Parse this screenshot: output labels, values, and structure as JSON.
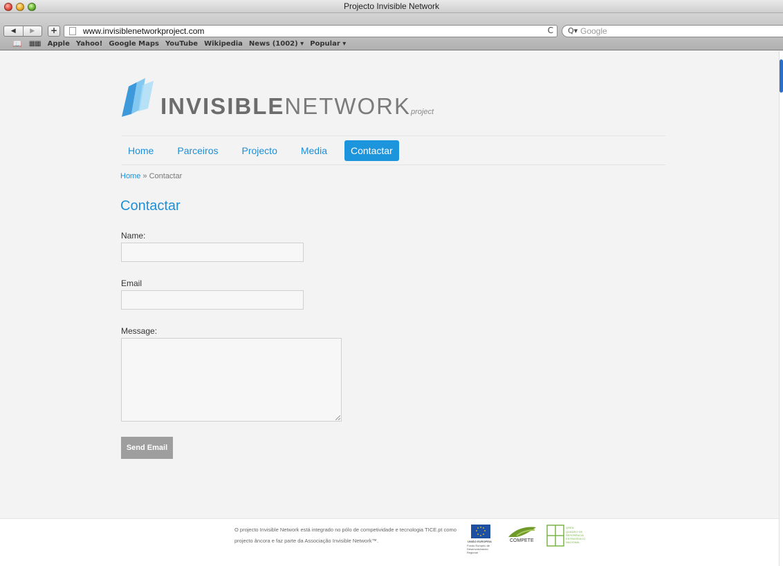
{
  "window": {
    "title": "Projecto Invisible Network"
  },
  "toolbar": {
    "back": "◀",
    "forward": "▶",
    "add": "+",
    "url": "www.invisiblenetworkproject.com",
    "reload": "C",
    "search_placeholder": "Google"
  },
  "bookmarks": [
    "Apple",
    "Yahoo!",
    "Google Maps",
    "YouTube",
    "Wikipedia",
    "News (1002) ▾",
    "Popular ▾"
  ],
  "logo": {
    "bold": "INVISIBLE",
    "light": "NETWORK",
    "sub": "project"
  },
  "nav": {
    "home": "Home",
    "parceiros": "Parceiros",
    "projecto": "Projecto",
    "media": "Media",
    "contactar": "Contactar"
  },
  "breadcrumb": {
    "home": "Home",
    "sep": " » ",
    "current": "Contactar"
  },
  "page_title": "Contactar",
  "form": {
    "name_label": "Name:",
    "email_label": "Email",
    "message_label": "Message:",
    "submit": "Send Email"
  },
  "footer": {
    "text": "O projecto Invisible Network está integrado no pólo de competividade e tecnologia TICE.pt como projecto âncora e faz parte da Associação Invisible Network™.",
    "eu_label": "UNIÃO EUROPEIA",
    "eu_sub": "Fundo Europeu de Desenvolvimento Regional",
    "compete_label": "COMPETE",
    "qren_label": "QREN",
    "qren_sub": "QUADRO DE REFERÊNCIA ESTRATÉGICO NACIONAL"
  },
  "colors": {
    "accent": "#1d95dd",
    "button_gray": "#9e9e9e"
  }
}
